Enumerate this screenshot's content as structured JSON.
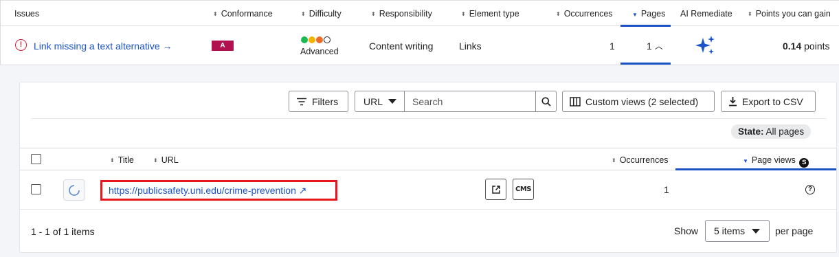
{
  "issues_table": {
    "headers": {
      "issues": "Issues",
      "conformance": "Conformance",
      "difficulty": "Difficulty",
      "responsibility": "Responsibility",
      "element_type": "Element type",
      "occurrences": "Occurrences",
      "pages": "Pages",
      "ai_remediate": "AI Remediate",
      "points": "Points you can gain"
    },
    "row": {
      "issue": "Link missing a text alternative →",
      "conformance": "A",
      "difficulty": "Advanced",
      "responsibility": "Content writing",
      "element_type": "Links",
      "occurrences": "1",
      "pages": "1",
      "points_value": "0.14",
      "points_unit": "points"
    },
    "colors": {
      "error": "#d0213c",
      "badge_a": "#b0124f",
      "difficulty_dots": [
        "#1db954",
        "#f5b400",
        "#ef6c2b",
        "#ffffff"
      ]
    }
  },
  "toolbar": {
    "filters": "Filters",
    "url_select": "URL",
    "search_placeholder": "Search",
    "custom_views": "Custom views (2 selected)",
    "export_csv": "Export to CSV"
  },
  "state": {
    "label": "State:",
    "value": "All pages"
  },
  "pages_table": {
    "headers": {
      "title": "Title",
      "url": "URL",
      "occurrences": "Occurrences",
      "page_views": "Page views",
      "page_views_badge": "S"
    },
    "rows": [
      {
        "url": "https://publicsafety.uni.edu/crime-prevention ↗",
        "cms": "CMS",
        "occurrences": "1"
      }
    ]
  },
  "footer": {
    "count": "1 - 1 of 1 items",
    "show": "Show",
    "items_per_page": "5 items",
    "per_page": "per page"
  },
  "accent": "#1a52c8"
}
